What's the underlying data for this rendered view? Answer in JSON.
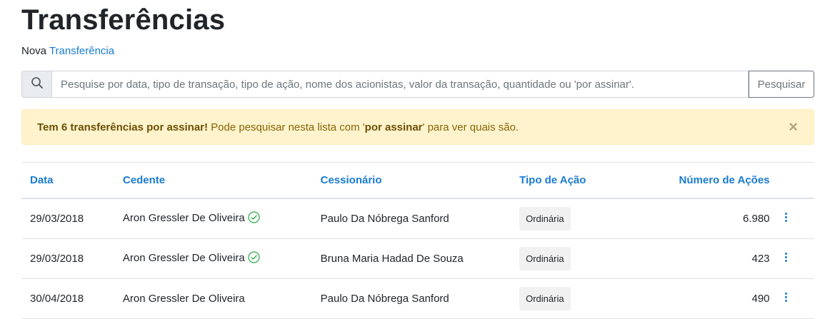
{
  "page_title": "Transferências",
  "subnav": {
    "prefix": "Nova",
    "link": "Transferência"
  },
  "search": {
    "icon": "search-icon",
    "placeholder": "Pesquise por data, tipo de transação, tipo de ação, nome dos acionistas, valor da transação, quantidade ou 'por assinar'.",
    "value": "",
    "button_label": "Pesquisar"
  },
  "alert": {
    "bold": "Tem 6 transferências por assinar!",
    "text_1": " Pode pesquisar nesta lista com '",
    "keyword": "por assinar",
    "text_2": "' para ver quais são.",
    "close_label": "×"
  },
  "table": {
    "headers": {
      "date": "Data",
      "cedente": "Cedente",
      "cessionario": "Cessionário",
      "tipo": "Tipo de Ação",
      "numero": "Número de Ações"
    },
    "rows": [
      {
        "date": "29/03/2018",
        "cedente": "Aron Gressler De Oliveira",
        "verified": true,
        "cessionario": "Paulo Da Nóbrega Sanford",
        "tipo": "Ordinária",
        "numero": "6.980"
      },
      {
        "date": "29/03/2018",
        "cedente": "Aron Gressler De Oliveira",
        "verified": true,
        "cessionario": "Bruna Maria Hadad De Souza",
        "tipo": "Ordinária",
        "numero": "423"
      },
      {
        "date": "30/04/2018",
        "cedente": "Aron Gressler De Oliveira",
        "verified": false,
        "cessionario": "Paulo Da Nóbrega Sanford",
        "tipo": "Ordinária",
        "numero": "490"
      }
    ]
  },
  "colors": {
    "link": "#1a7bd1",
    "warning_bg": "#fff3cd",
    "warning_text": "#856404",
    "verified": "#28a745"
  }
}
